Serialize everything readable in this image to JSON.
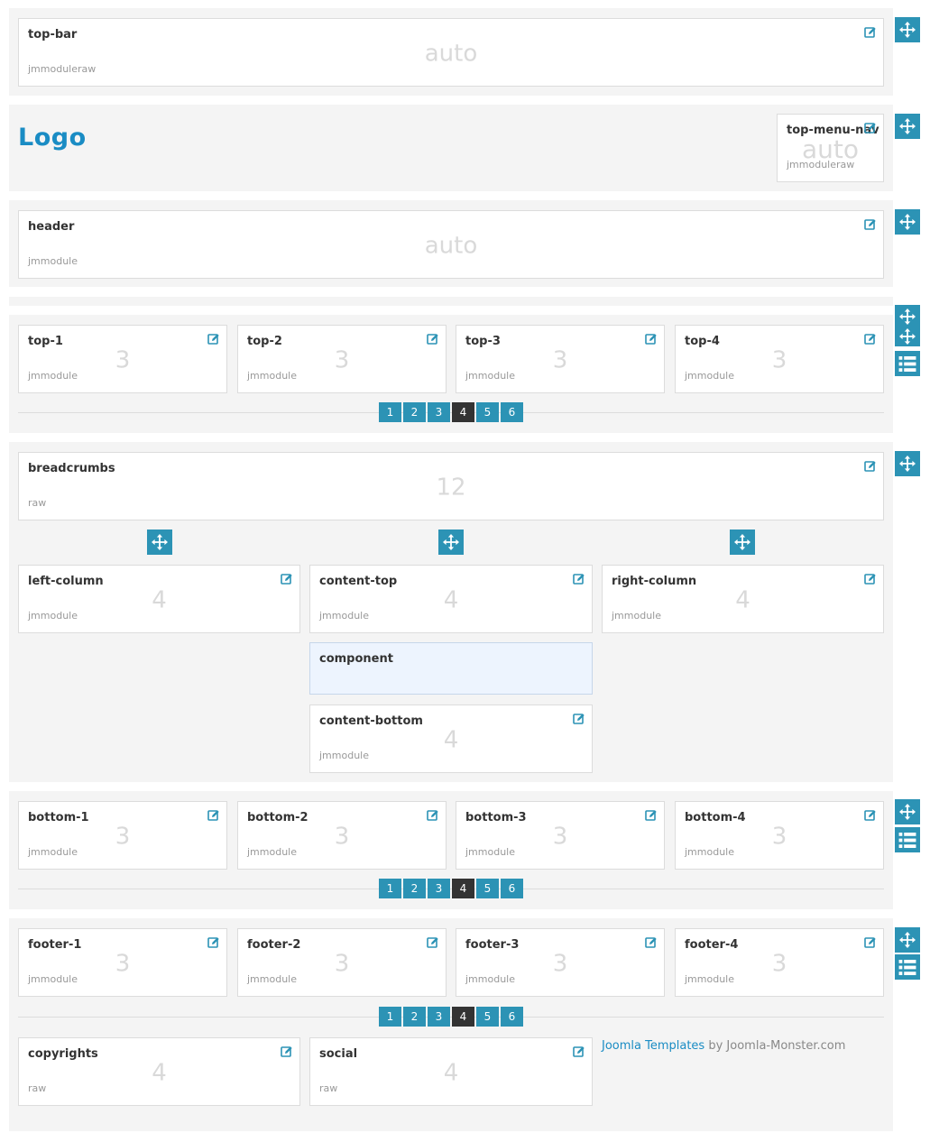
{
  "sections": {
    "top_bar": {
      "title": "top-bar",
      "type": "jmmoduleraw",
      "size": "auto"
    },
    "logo": {
      "text": "Logo"
    },
    "top_menu_nav": {
      "title": "top-menu-nav",
      "type": "jmmoduleraw",
      "size": "auto"
    },
    "header": {
      "title": "header",
      "type": "jmmodule",
      "size": "auto"
    },
    "top": [
      {
        "title": "top-1",
        "type": "jmmodule",
        "size": "3"
      },
      {
        "title": "top-2",
        "type": "jmmodule",
        "size": "3"
      },
      {
        "title": "top-3",
        "type": "jmmodule",
        "size": "3"
      },
      {
        "title": "top-4",
        "type": "jmmodule",
        "size": "3"
      }
    ],
    "breadcrumbs": {
      "title": "breadcrumbs",
      "type": "raw",
      "size": "12"
    },
    "left_column": {
      "title": "left-column",
      "type": "jmmodule",
      "size": "4"
    },
    "content_top": {
      "title": "content-top",
      "type": "jmmodule",
      "size": "4"
    },
    "right_column": {
      "title": "right-column",
      "type": "jmmodule",
      "size": "4"
    },
    "component": {
      "title": "component"
    },
    "content_bottom": {
      "title": "content-bottom",
      "type": "jmmodule",
      "size": "4"
    },
    "bottom": [
      {
        "title": "bottom-1",
        "type": "jmmodule",
        "size": "3"
      },
      {
        "title": "bottom-2",
        "type": "jmmodule",
        "size": "3"
      },
      {
        "title": "bottom-3",
        "type": "jmmodule",
        "size": "3"
      },
      {
        "title": "bottom-4",
        "type": "jmmodule",
        "size": "3"
      }
    ],
    "footer": [
      {
        "title": "footer-1",
        "type": "jmmodule",
        "size": "3"
      },
      {
        "title": "footer-2",
        "type": "jmmodule",
        "size": "3"
      },
      {
        "title": "footer-3",
        "type": "jmmodule",
        "size": "3"
      },
      {
        "title": "footer-4",
        "type": "jmmodule",
        "size": "3"
      }
    ],
    "copyrights": {
      "title": "copyrights",
      "type": "raw",
      "size": "4"
    },
    "social": {
      "title": "social",
      "type": "raw",
      "size": "4"
    }
  },
  "pagination": [
    "1",
    "2",
    "3",
    "4",
    "5",
    "6"
  ],
  "pagination_active": "4",
  "credit": {
    "link": "Joomla Templates",
    "rest": " by Joomla-Monster.com"
  },
  "colors": {
    "accent": "#2c93b5",
    "active_page": "#333333",
    "logo": "#1a8cc4",
    "component_bg": "#edf4fe"
  },
  "icons": {
    "edit": "edit-icon",
    "move": "move-icon",
    "list": "list-icon"
  }
}
